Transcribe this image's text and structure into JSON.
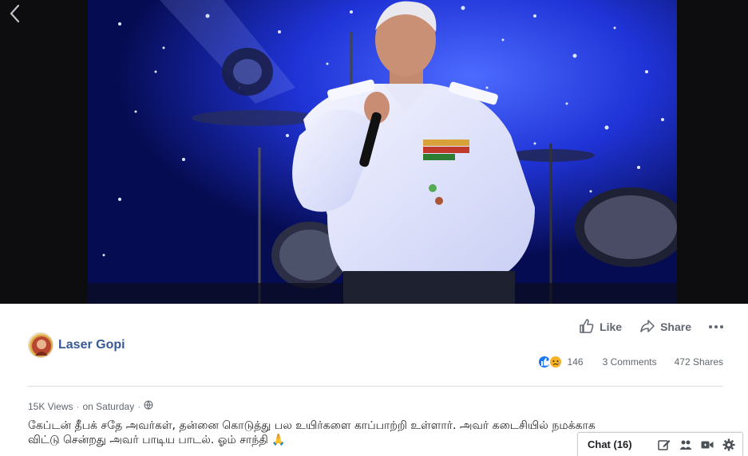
{
  "post": {
    "author": "Laser Gopi",
    "actions": {
      "like": "Like",
      "share": "Share"
    },
    "stats": {
      "reactions_count": "146",
      "comments": "3 Comments",
      "shares": "472 Shares"
    },
    "meta": {
      "views": "15K Views",
      "time": "on Saturday"
    },
    "caption_line1": "கேப்டன் தீபக் சதே அவர்கள், தன்னை கொடுத்து பல உயிர்களை காப்பாற்றி உள்ளார். அவர் கடைசியில் நமக்காக",
    "caption_line2": "விட்டு சென்றது அவர் பாடிய பாடல். ஓம் சாந்தி 🙏"
  },
  "chat": {
    "label": "Chat (16)"
  },
  "icons": {
    "back": "chevron-left-icon",
    "like": "thumbs-up-icon",
    "share": "share-arrow-icon",
    "more": "ellipsis-icon",
    "privacy": "globe-icon",
    "reaction_like": "like-reaction-icon",
    "reaction_sad": "sad-reaction-icon",
    "chat_new": "compose-icon",
    "chat_group": "group-icon",
    "chat_video": "video-camera-icon",
    "chat_settings": "gear-icon"
  },
  "colors": {
    "link": "#385898",
    "secondary_text": "#606770",
    "like_blue": "#1877f2",
    "sad_yellow": "#f7b125"
  }
}
